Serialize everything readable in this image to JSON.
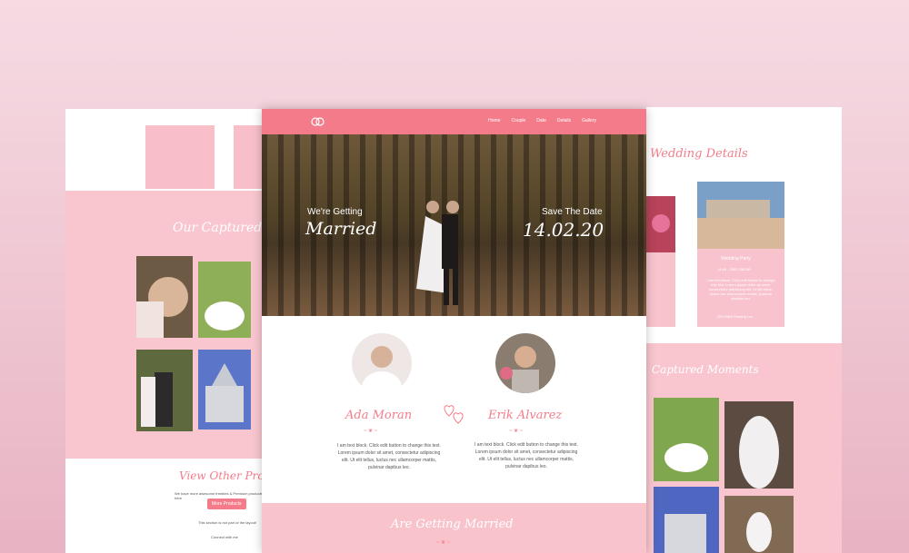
{
  "nav": {
    "items": [
      "Home",
      "Couple",
      "Date",
      "Details",
      "Gallery"
    ]
  },
  "hero": {
    "left_small": "We're Getting",
    "left_big": "Married",
    "right_small": "Save The Date",
    "right_big": "14.02.20"
  },
  "couple": {
    "bride": {
      "name": "Ada Moran",
      "bio": "I am text block. Click edit button to change this text. Lorem ipsum dolor sit amet, consectetur adipiscing elit. Ut elit tellus, luctus nec ullamcorper mattis, pulvinar dapibus leo."
    },
    "groom": {
      "name": "Erik Alvarez",
      "bio": "I am text block. Click edit button to change this text. Lorem ipsum dolor sit amet, consectetur adipiscing elit. Ut elit tellus, luctus nec ullamcorper mattis, pulvinar dapibus leo."
    }
  },
  "footer": {
    "title": "Are Getting Married"
  },
  "left_page": {
    "heading": "Our Captured Mom",
    "promo_title": "View Other Produc",
    "promo_text": "We have more awesome freebies & Premium products here",
    "button": "More Products",
    "section_note": "This section is not part of the layout!",
    "connect": "Connect with me"
  },
  "right_page": {
    "heading": "Wedding Details",
    "card_title": "Wedding Party",
    "card_time": "14:45 - 2500 230 BR",
    "card_text": "I am text block. Click edit button to change this text. Lorem ipsum dolor sit amet, consectetur adipiscing elit. Ut elit tellus, luctus nec ullamcorper mattis, pulvinar dapibus leo.",
    "card_footer": "200 NWS Resting Loc",
    "moments": "Captured Moments"
  },
  "colors": {
    "accent": "#f47c8a",
    "soft_pink": "#f9c3cc"
  }
}
